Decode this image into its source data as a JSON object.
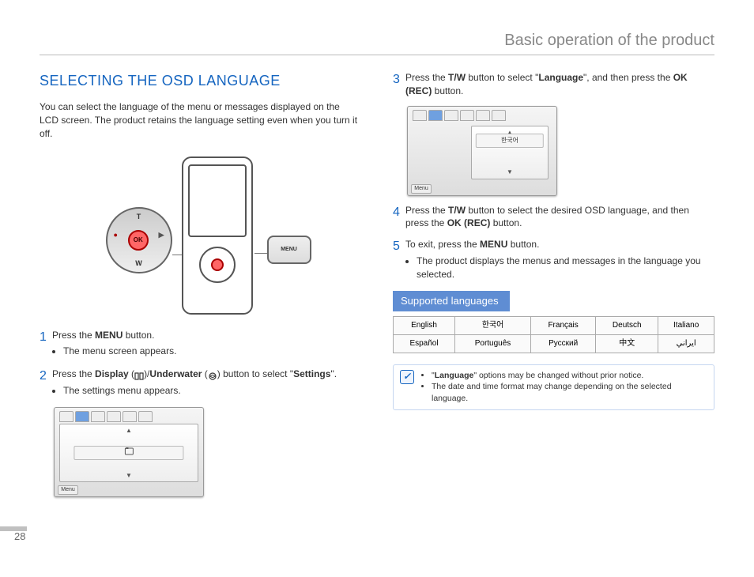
{
  "page_number": "28",
  "header": "Basic operation of the product",
  "section_title": "SELECTING THE OSD LANGUAGE",
  "intro": "You can select the language of the menu or messages displayed on the LCD screen. The product retains the language setting even when you turn it off.",
  "device": {
    "t": "T",
    "w": "W",
    "ok": "OK",
    "menu": "MENU",
    "rec_icon": "●",
    "play_icon": "▶"
  },
  "step1": {
    "num": "1",
    "text_a": "Press the ",
    "menu": "MENU",
    "text_b": " button.",
    "bullet": "The menu screen appears."
  },
  "step2": {
    "num": "2",
    "text_a": "Press the ",
    "display": "Display",
    "text_b": " (",
    "text_c": ")/",
    "underwater": "Underwater",
    "text_d": " (",
    "text_e": ") button to select \"",
    "settings": "Settings",
    "text_f": "\".",
    "bullet": "The settings menu appears."
  },
  "step3": {
    "num": "3",
    "text_a": "Press the ",
    "tw": "T/W",
    "text_b": " button to select \"",
    "language": "Language",
    "text_c": "\", and then press the ",
    "okrec": "OK (REC)",
    "text_d": " button."
  },
  "step4": {
    "num": "4",
    "text_a": "Press the ",
    "tw": "T/W",
    "text_b": " button to select the desired OSD language, and then press the ",
    "okrec": "OK (REC)",
    "text_c": " button."
  },
  "step5": {
    "num": "5",
    "text_a": "To exit, press the ",
    "menu": "MENU",
    "text_b": " button.",
    "bullet": "The product displays the menus and messages in the language you selected."
  },
  "screenshot": {
    "menu_label": "Menu",
    "korean": "한국어"
  },
  "languages": {
    "header": "Supported languages",
    "rows": [
      [
        "English",
        "한국어",
        "Français",
        "Deutsch",
        "Italiano"
      ],
      [
        "Español",
        "Português",
        "Русский",
        "中文",
        "ايراني"
      ]
    ]
  },
  "notes": {
    "n1_a": "\"",
    "n1_lang": "Language",
    "n1_b": "\" options may be changed without prior notice.",
    "n2": "The date and time format may change depending on the selected language."
  }
}
